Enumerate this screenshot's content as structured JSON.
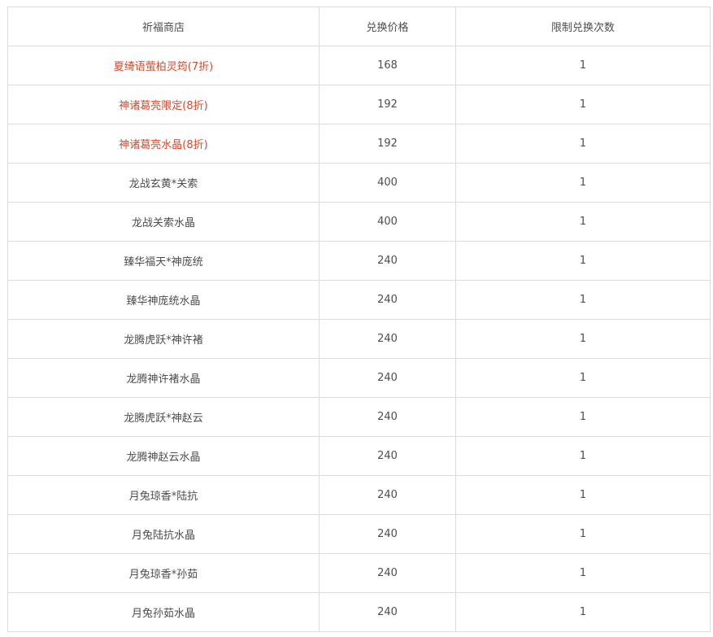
{
  "table": {
    "headers": [
      "祈福商店",
      "兑换价格",
      "限制兑换次数"
    ],
    "rows": [
      {
        "name": "夏绮语萤柏灵筠(7折)",
        "price": "168",
        "limit": "1",
        "highlight": true
      },
      {
        "name": "神诸葛亮限定(8折)",
        "price": "192",
        "limit": "1",
        "highlight": true
      },
      {
        "name": "神诸葛亮水晶(8折)",
        "price": "192",
        "limit": "1",
        "highlight": true
      },
      {
        "name": "龙战玄黄*关索",
        "price": "400",
        "limit": "1",
        "highlight": false
      },
      {
        "name": "龙战关索水晶",
        "price": "400",
        "limit": "1",
        "highlight": false
      },
      {
        "name": "臻华福天*神庞统",
        "price": "240",
        "limit": "1",
        "highlight": false
      },
      {
        "name": "臻华神庞统水晶",
        "price": "240",
        "limit": "1",
        "highlight": false
      },
      {
        "name": "龙腾虎跃*神许褚",
        "price": "240",
        "limit": "1",
        "highlight": false
      },
      {
        "name": "龙腾神许褚水晶",
        "price": "240",
        "limit": "1",
        "highlight": false
      },
      {
        "name": "龙腾虎跃*神赵云",
        "price": "240",
        "limit": "1",
        "highlight": false
      },
      {
        "name": "龙腾神赵云水晶",
        "price": "240",
        "limit": "1",
        "highlight": false
      },
      {
        "name": "月兔琼香*陆抗",
        "price": "240",
        "limit": "1",
        "highlight": false
      },
      {
        "name": "月兔陆抗水晶",
        "price": "240",
        "limit": "1",
        "highlight": false
      },
      {
        "name": "月兔琼香*孙茹",
        "price": "240",
        "limit": "1",
        "highlight": false
      },
      {
        "name": "月兔孙茹水晶",
        "price": "240",
        "limit": "1",
        "highlight": false
      }
    ]
  },
  "colors": {
    "text": "#4d4d4d",
    "highlight_text": "#d9472b",
    "border": "#dcdcdc",
    "background": "#ffffff"
  }
}
